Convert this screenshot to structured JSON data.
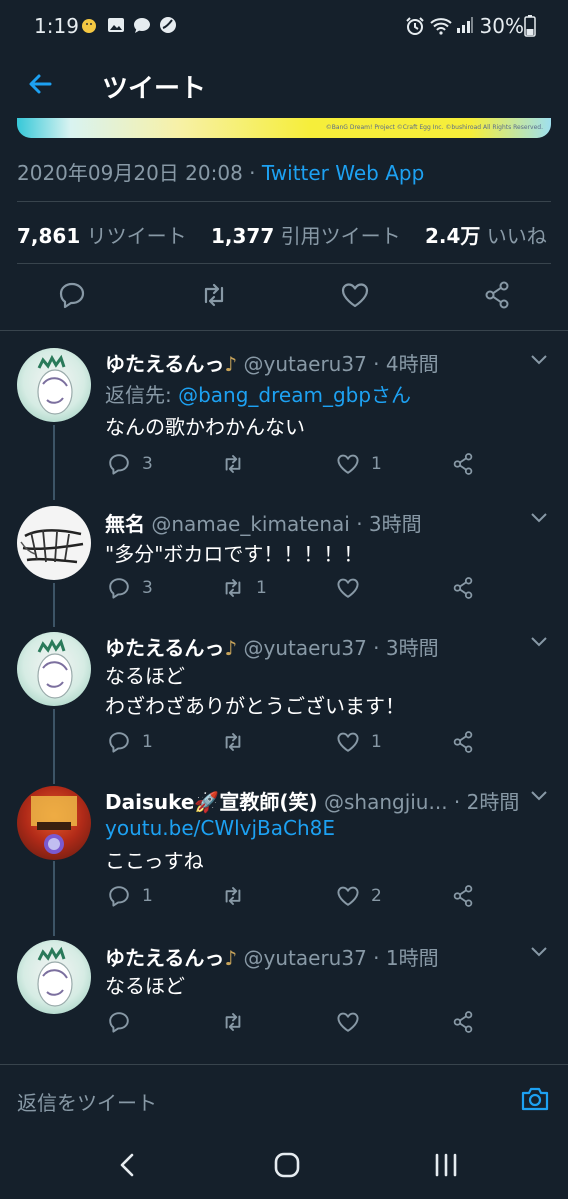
{
  "status_bar": {
    "time": "1:19",
    "battery": "30%"
  },
  "header": {
    "title": "ツイート"
  },
  "media": {
    "copyright": "©BanG Dream! Project ©Craft Egg Inc. ©bushiroad All Rights Reserved."
  },
  "tweet": {
    "timestamp": "2020年09月20日 20:08",
    "separator": " · ",
    "source": "Twitter Web App",
    "retweets": "7,861",
    "retweets_label": "リツイート",
    "quotes": "1,377",
    "quotes_label": "引用ツイート",
    "likes": "2.4万",
    "likes_label": "いいね"
  },
  "replies": [
    {
      "name": "ゆたえるんっ",
      "emoji": "♪",
      "handle": "@yutaeru37",
      "time": "· 4時間",
      "reply_to_prefix": "返信先: ",
      "reply_to": "@bang_dream_gbpさん",
      "text": "なんの歌かわかんない",
      "replies": "3",
      "retweets": "",
      "likes": "1"
    },
    {
      "name": "無名",
      "emoji": "",
      "handle": "@namae_kimatenai",
      "time": "· 3時間",
      "text": "\"多分\"ボカロです！！！！！",
      "replies": "3",
      "retweets": "1",
      "likes": ""
    },
    {
      "name": "ゆたえるんっ",
      "emoji": "♪",
      "handle": "@yutaeru37",
      "time": "· 3時間",
      "text": "なるほど",
      "text2": "わざわざありがとうございます！",
      "replies": "1",
      "retweets": "",
      "likes": "1"
    },
    {
      "name": "Daisuke🚀宣教師(笑)",
      "emoji": "",
      "handle": "@shangjiu...",
      "time": "· 2時間",
      "link": "youtu.be/CWlvjBaCh8E",
      "text": "ここっすね",
      "replies": "1",
      "retweets": "",
      "likes": "2"
    },
    {
      "name": "ゆたえるんっ",
      "emoji": "♪",
      "handle": "@yutaeru37",
      "time": "· 1時間",
      "text": "なるほど",
      "replies": "",
      "retweets": "",
      "likes": ""
    }
  ],
  "compose": {
    "placeholder": "返信をツイート"
  },
  "colors": {
    "background": "#15202b",
    "accent": "#1da1f2",
    "muted": "#8899a6",
    "divider": "#38444d"
  }
}
